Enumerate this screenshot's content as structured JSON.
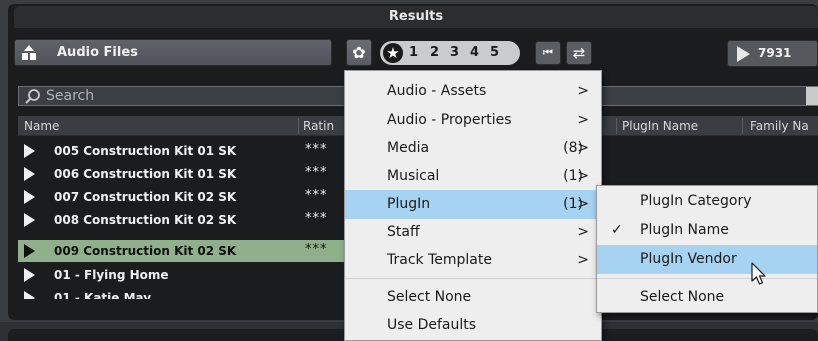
{
  "window": {
    "title": "Results"
  },
  "toolbar": {
    "media_type": "Audio Files",
    "media_icon": "media-type-icon",
    "settings_icon": "gear-icon",
    "rating_filter": {
      "all_symbol": "★",
      "levels": [
        "1",
        "2",
        "3",
        "4",
        "5"
      ]
    },
    "prev_icon": "previous-icon",
    "shuffle_icon": "shuffle-icon",
    "result_count": "7931"
  },
  "search": {
    "placeholder": "Search"
  },
  "table": {
    "columns": [
      "Name",
      "Ratin",
      "PlugIn Name",
      "Family Na"
    ],
    "rows": [
      {
        "name": "005 Construction Kit 01 SK",
        "rating": "***",
        "selected": false
      },
      {
        "name": "006 Construction Kit 01 SK",
        "rating": "***",
        "selected": false
      },
      {
        "name": "007 Construction Kit 02 SK",
        "rating": "***",
        "selected": false
      },
      {
        "name": "008 Construction Kit 02 SK",
        "rating": "***",
        "selected": false
      },
      {
        "name": "009 Construction Kit 02 SK",
        "rating": "***",
        "selected": true
      },
      {
        "name": "01 - Flying Home",
        "rating": "",
        "selected": false
      },
      {
        "name": "01 - Katie May",
        "rating": "",
        "selected": false
      }
    ]
  },
  "column_menu": {
    "items": [
      {
        "label": "Audio - Assets",
        "count": "",
        "submenu": true
      },
      {
        "label": "Audio - Properties",
        "count": "",
        "submenu": true
      },
      {
        "label": "Media",
        "count": "(8)",
        "submenu": true
      },
      {
        "label": "Musical",
        "count": "(1)",
        "submenu": true
      },
      {
        "label": "PlugIn",
        "count": "(1)",
        "submenu": true,
        "highlighted": true
      },
      {
        "label": "Staff",
        "count": "",
        "submenu": true
      },
      {
        "label": "Track Template",
        "count": "",
        "submenu": true
      },
      {
        "label": "Select None"
      },
      {
        "label": "Use Defaults"
      }
    ],
    "chevron": ">"
  },
  "plugin_submenu": {
    "items": [
      {
        "label": "PlugIn Category",
        "checked": false
      },
      {
        "label": "PlugIn Name",
        "checked": true
      },
      {
        "label": "PlugIn Vendor",
        "checked": false,
        "highlighted": true
      },
      {
        "label": "Select None",
        "checked": false
      }
    ],
    "check_mark": "✓"
  },
  "colors": {
    "highlight": "#a7d3f2",
    "selected_row": "#8fb08a",
    "panel": "#1b1c1e"
  }
}
